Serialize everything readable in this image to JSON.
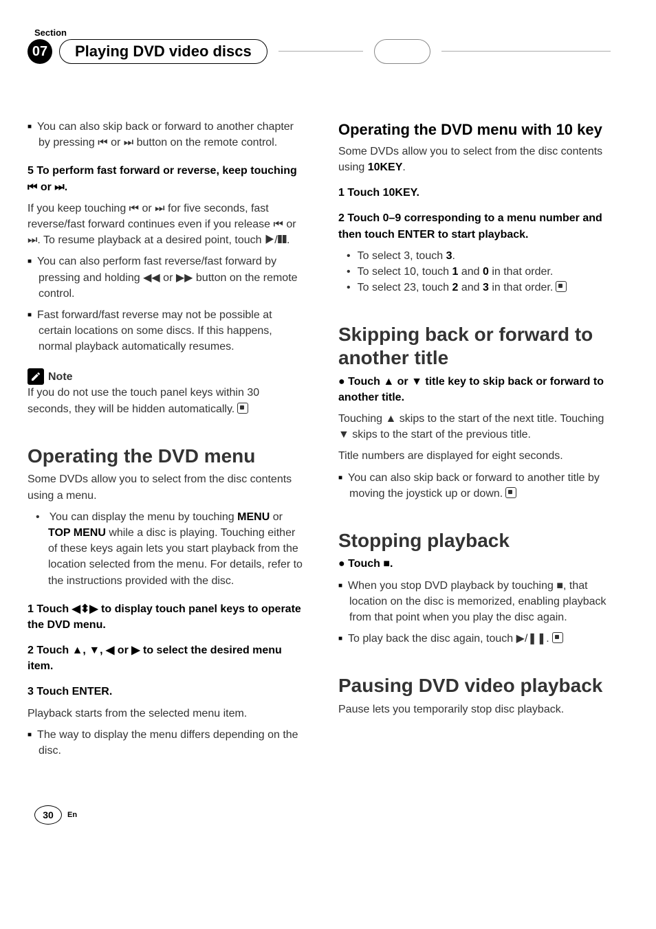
{
  "section_label": "Section",
  "section_number": "07",
  "chapter_title": "Playing DVD video discs",
  "left": {
    "p1": "You can also skip back or forward to another chapter by pressing ⏮ or ⏭ button on the remote control.",
    "step5_line1": "5    To perform fast forward or reverse, keep touching ⏮ or ⏭.",
    "p2": "If you keep touching ⏮ or ⏭ for five seconds, fast reverse/fast forward continues even if you release ⏮ or ⏭. To resume playback at a desired point, touch ▶/❚❚.",
    "p3": "You can also perform fast reverse/fast forward by pressing and holding ◀◀ or ▶▶ button on the remote control.",
    "p4": "Fast forward/fast reverse may not be possible at certain locations on some discs. If this happens, normal playback automatically resumes.",
    "note_label": "Note",
    "note_body": "If you do not use the touch panel keys within 30 seconds, they will be hidden automatically.",
    "h1_operating": "Operating the DVD menu",
    "p5": "Some DVDs allow you to select from the disc contents using a menu.",
    "bullet1a": "You can display the menu by touching ",
    "bullet1b": "MENU",
    "bullet1c": " or ",
    "bullet1d": "TOP MENU",
    "bullet1e": " while a disc is playing. Touching either of these keys again lets you start playback from the location selected from the menu. For details, refer to the instructions provided with the disc.",
    "step1": "1    Touch ◀⬍▶ to display touch panel keys to operate the DVD menu.",
    "step2": "2    Touch ▲, ▼, ◀ or ▶ to select the desired menu item.",
    "step3": "3    Touch ENTER.",
    "p6": "Playback starts from the selected menu item.",
    "p7": "The way to display the menu differs depending on the disc."
  },
  "right": {
    "h2_10key": "Operating the DVD menu with 10 key",
    "p1a": "Some DVDs allow you to select from the disc contents using ",
    "p1b": "10KEY",
    "p1c": ".",
    "step1": "1    Touch 10KEY.",
    "step2": "2    Touch 0–9 corresponding to a menu number and then touch ENTER to start playback.",
    "li1a": "To select 3, touch ",
    "li1b": "3",
    "li1c": ".",
    "li2a": "To select 10, touch ",
    "li2b1": "1",
    "li2c": " and ",
    "li2b2": "0",
    "li2d": " in that order.",
    "li3a": "To select 23, touch ",
    "li3b1": "2",
    "li3c": " and ",
    "li3b2": "3",
    "li3d": " in that order.",
    "h1_skip": "Skipping back or forward to another title",
    "skip_step": "●   Touch ▲ or ▼ title key to skip back or forward to another title.",
    "skip_p1": "Touching ▲ skips to the start of the next title. Touching ▼ skips to the start of the previous title.",
    "skip_p2": "Title numbers are displayed for eight seconds.",
    "skip_p3": "You can also skip back or forward to another title by moving the joystick up or down.",
    "h1_stop": "Stopping playback",
    "stop_step": "●   Touch ■.",
    "stop_p1": "When you stop DVD playback by touching ■, that location on the disc is memorized, enabling playback from that point when you play the disc again.",
    "stop_p2": "To play back the disc again, touch ▶/❚❚.",
    "h1_pause": "Pausing DVD video playback",
    "pause_p1": "Pause lets you temporarily stop disc playback."
  },
  "footer": {
    "page": "30",
    "lang": "En"
  }
}
